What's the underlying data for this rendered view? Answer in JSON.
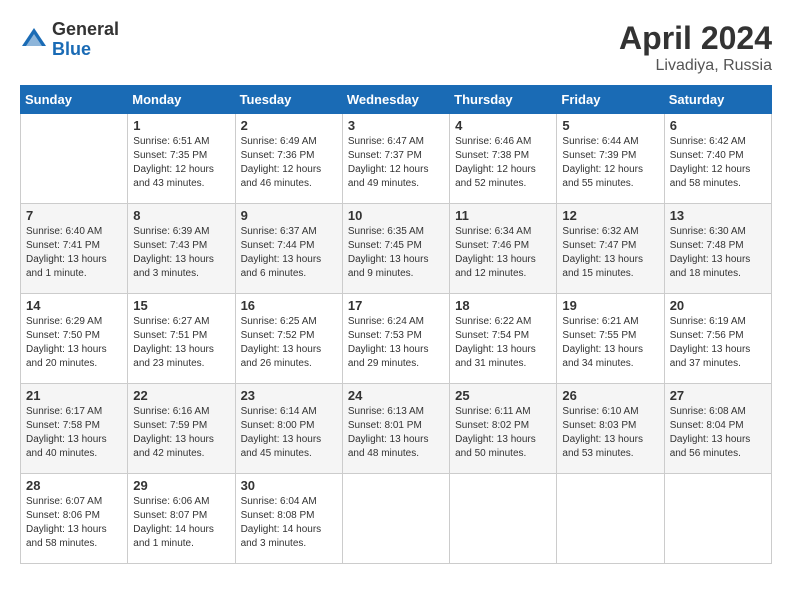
{
  "header": {
    "logo_general": "General",
    "logo_blue": "Blue",
    "month_year": "April 2024",
    "location": "Livadiya, Russia"
  },
  "days_of_week": [
    "Sunday",
    "Monday",
    "Tuesday",
    "Wednesday",
    "Thursday",
    "Friday",
    "Saturday"
  ],
  "weeks": [
    [
      {
        "day": "",
        "info": ""
      },
      {
        "day": "1",
        "info": "Sunrise: 6:51 AM\nSunset: 7:35 PM\nDaylight: 12 hours\nand 43 minutes."
      },
      {
        "day": "2",
        "info": "Sunrise: 6:49 AM\nSunset: 7:36 PM\nDaylight: 12 hours\nand 46 minutes."
      },
      {
        "day": "3",
        "info": "Sunrise: 6:47 AM\nSunset: 7:37 PM\nDaylight: 12 hours\nand 49 minutes."
      },
      {
        "day": "4",
        "info": "Sunrise: 6:46 AM\nSunset: 7:38 PM\nDaylight: 12 hours\nand 52 minutes."
      },
      {
        "day": "5",
        "info": "Sunrise: 6:44 AM\nSunset: 7:39 PM\nDaylight: 12 hours\nand 55 minutes."
      },
      {
        "day": "6",
        "info": "Sunrise: 6:42 AM\nSunset: 7:40 PM\nDaylight: 12 hours\nand 58 minutes."
      }
    ],
    [
      {
        "day": "7",
        "info": "Sunrise: 6:40 AM\nSunset: 7:41 PM\nDaylight: 13 hours\nand 1 minute."
      },
      {
        "day": "8",
        "info": "Sunrise: 6:39 AM\nSunset: 7:43 PM\nDaylight: 13 hours\nand 3 minutes."
      },
      {
        "day": "9",
        "info": "Sunrise: 6:37 AM\nSunset: 7:44 PM\nDaylight: 13 hours\nand 6 minutes."
      },
      {
        "day": "10",
        "info": "Sunrise: 6:35 AM\nSunset: 7:45 PM\nDaylight: 13 hours\nand 9 minutes."
      },
      {
        "day": "11",
        "info": "Sunrise: 6:34 AM\nSunset: 7:46 PM\nDaylight: 13 hours\nand 12 minutes."
      },
      {
        "day": "12",
        "info": "Sunrise: 6:32 AM\nSunset: 7:47 PM\nDaylight: 13 hours\nand 15 minutes."
      },
      {
        "day": "13",
        "info": "Sunrise: 6:30 AM\nSunset: 7:48 PM\nDaylight: 13 hours\nand 18 minutes."
      }
    ],
    [
      {
        "day": "14",
        "info": "Sunrise: 6:29 AM\nSunset: 7:50 PM\nDaylight: 13 hours\nand 20 minutes."
      },
      {
        "day": "15",
        "info": "Sunrise: 6:27 AM\nSunset: 7:51 PM\nDaylight: 13 hours\nand 23 minutes."
      },
      {
        "day": "16",
        "info": "Sunrise: 6:25 AM\nSunset: 7:52 PM\nDaylight: 13 hours\nand 26 minutes."
      },
      {
        "day": "17",
        "info": "Sunrise: 6:24 AM\nSunset: 7:53 PM\nDaylight: 13 hours\nand 29 minutes."
      },
      {
        "day": "18",
        "info": "Sunrise: 6:22 AM\nSunset: 7:54 PM\nDaylight: 13 hours\nand 31 minutes."
      },
      {
        "day": "19",
        "info": "Sunrise: 6:21 AM\nSunset: 7:55 PM\nDaylight: 13 hours\nand 34 minutes."
      },
      {
        "day": "20",
        "info": "Sunrise: 6:19 AM\nSunset: 7:56 PM\nDaylight: 13 hours\nand 37 minutes."
      }
    ],
    [
      {
        "day": "21",
        "info": "Sunrise: 6:17 AM\nSunset: 7:58 PM\nDaylight: 13 hours\nand 40 minutes."
      },
      {
        "day": "22",
        "info": "Sunrise: 6:16 AM\nSunset: 7:59 PM\nDaylight: 13 hours\nand 42 minutes."
      },
      {
        "day": "23",
        "info": "Sunrise: 6:14 AM\nSunset: 8:00 PM\nDaylight: 13 hours\nand 45 minutes."
      },
      {
        "day": "24",
        "info": "Sunrise: 6:13 AM\nSunset: 8:01 PM\nDaylight: 13 hours\nand 48 minutes."
      },
      {
        "day": "25",
        "info": "Sunrise: 6:11 AM\nSunset: 8:02 PM\nDaylight: 13 hours\nand 50 minutes."
      },
      {
        "day": "26",
        "info": "Sunrise: 6:10 AM\nSunset: 8:03 PM\nDaylight: 13 hours\nand 53 minutes."
      },
      {
        "day": "27",
        "info": "Sunrise: 6:08 AM\nSunset: 8:04 PM\nDaylight: 13 hours\nand 56 minutes."
      }
    ],
    [
      {
        "day": "28",
        "info": "Sunrise: 6:07 AM\nSunset: 8:06 PM\nDaylight: 13 hours\nand 58 minutes."
      },
      {
        "day": "29",
        "info": "Sunrise: 6:06 AM\nSunset: 8:07 PM\nDaylight: 14 hours\nand 1 minute."
      },
      {
        "day": "30",
        "info": "Sunrise: 6:04 AM\nSunset: 8:08 PM\nDaylight: 14 hours\nand 3 minutes."
      },
      {
        "day": "",
        "info": ""
      },
      {
        "day": "",
        "info": ""
      },
      {
        "day": "",
        "info": ""
      },
      {
        "day": "",
        "info": ""
      }
    ]
  ]
}
